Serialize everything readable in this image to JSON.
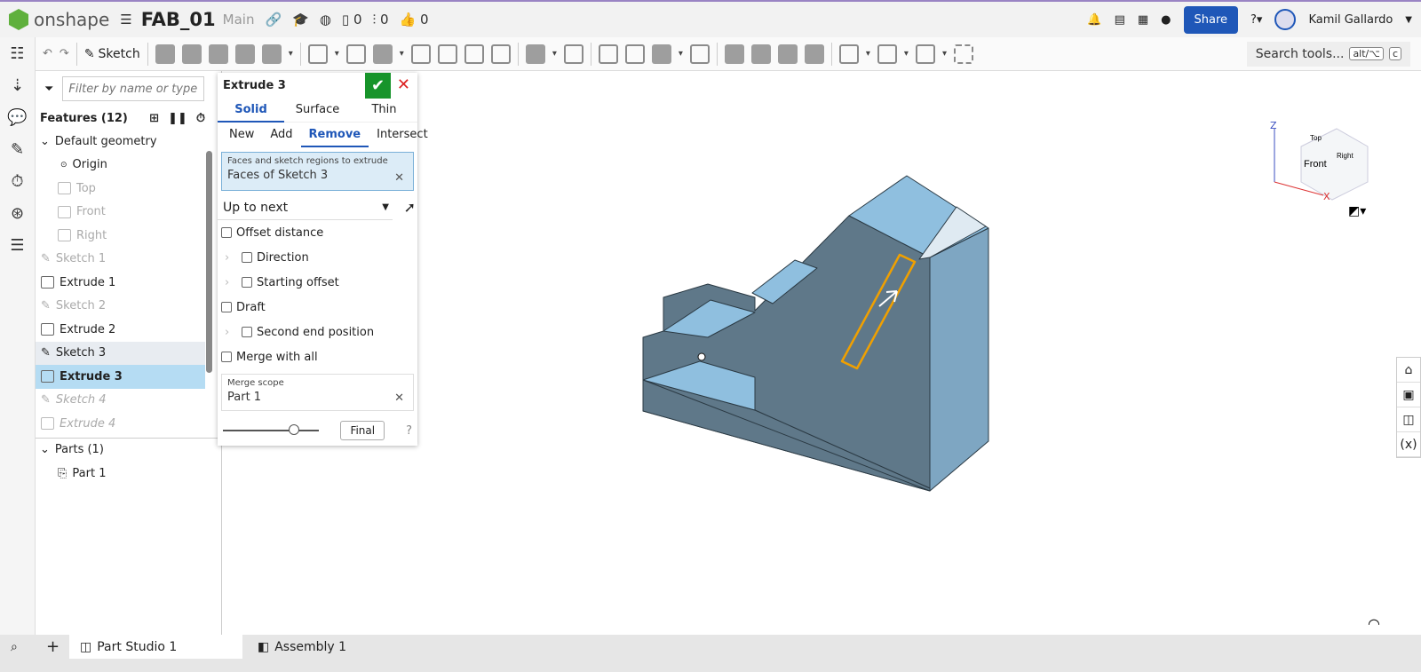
{
  "header": {
    "brand": "onshape",
    "doc_title": "FAB_01",
    "branch": "Main",
    "counts": {
      "versions": "0",
      "branches": "0",
      "likes": "0"
    },
    "share": "Share",
    "user": "Kamil Gallardo"
  },
  "toolbar": {
    "sketch": "Sketch",
    "search": "Search tools...",
    "shortcut1": "alt/⌥",
    "shortcut2": "c"
  },
  "features": {
    "filter_placeholder": "Filter by name or type",
    "title": "Features (12)",
    "items": [
      {
        "label": "Default geometry"
      },
      {
        "label": "Origin"
      },
      {
        "label": "Top"
      },
      {
        "label": "Front"
      },
      {
        "label": "Right"
      },
      {
        "label": "Sketch 1"
      },
      {
        "label": "Extrude 1"
      },
      {
        "label": "Sketch 2"
      },
      {
        "label": "Extrude 2"
      },
      {
        "label": "Sketch 3"
      },
      {
        "label": "Extrude 3"
      },
      {
        "label": "Sketch 4"
      },
      {
        "label": "Extrude 4"
      }
    ],
    "parts_title": "Parts (1)",
    "part": "Part 1"
  },
  "dialog": {
    "title": "Extrude 3",
    "tabs": [
      "Solid",
      "Surface",
      "Thin"
    ],
    "ops": [
      "New",
      "Add",
      "Remove",
      "Intersect"
    ],
    "query_label": "Faces and sketch regions to extrude",
    "query_value": "Faces of Sketch 3",
    "end_type": "Up to next",
    "offset_distance": "Offset distance",
    "direction": "Direction",
    "starting_offset": "Starting offset",
    "draft": "Draft",
    "second_end": "Second end position",
    "merge_all": "Merge with all",
    "merge_scope_label": "Merge scope",
    "merge_scope_value": "Part 1",
    "final": "Final",
    "slider_value": 0.7
  },
  "viewcube": {
    "top": "Top",
    "front": "Front",
    "right": "Right",
    "z": "Z",
    "x": "X"
  },
  "tabs": {
    "part_studio": "Part Studio 1",
    "assembly": "Assembly 1"
  },
  "colors": {
    "accent": "#1f57b8",
    "ok": "#17942a",
    "face_light": "#8fbfdf",
    "face_dark": "#5f7889",
    "select": "#f0a000"
  }
}
